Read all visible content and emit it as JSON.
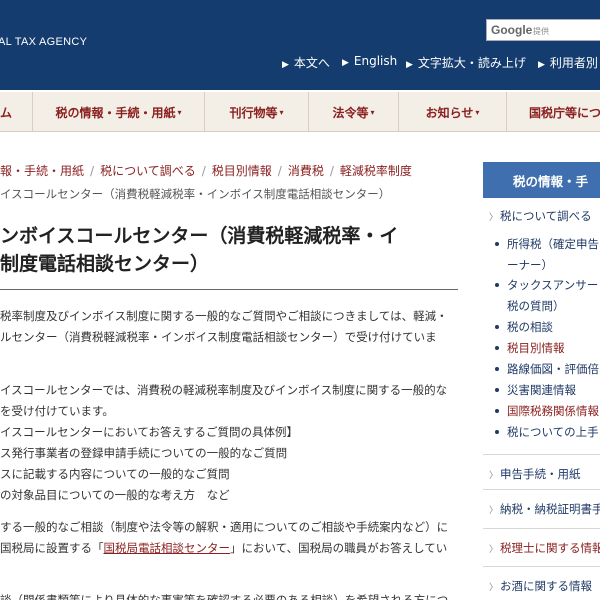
{
  "header": {
    "brand": "AL TAX AGENCY",
    "search_logo": "Google",
    "search_sub": "提供",
    "util_nav": [
      "本文へ",
      "English",
      "文字拡大・読み上げ",
      "利用者別"
    ]
  },
  "gnav": {
    "items": [
      "ム",
      "税の情報・手続・用紙",
      "刊行物等",
      "法令等",
      "お知らせ",
      "国税庁等につ"
    ]
  },
  "breadcrumb": {
    "items": [
      "報・手続・用紙",
      "税について調べる",
      "税目別情報",
      "消費税",
      "軽減税率制度"
    ],
    "current": "イスコールセンター（消費税軽減税率・インボイス制度電話相談センター）"
  },
  "main": {
    "title_line1": "ンボイスコールセンター（消費税軽減税率・イ",
    "title_line2": "制度電話相談センター）",
    "p1_line1": "税率制度及びインボイス制度に関する一般的なご質問やご相談につきましては、軽減・",
    "p1_line2": "ルセンター（消費税軽減税率・インボイス制度電話相談センター）で受け付けていま",
    "p2_line1": "イスコールセンターでは、消費税の軽減税率制度及びインボイス制度に関する一般的な",
    "p2_line2": "を受け付けています。",
    "p2_line3": "イスコールセンターにおいてお答えするご質問の具体例】",
    "p2_line4": "ス発行事業者の登録申請手続についての一般的なご質問",
    "p2_line5": "スに記載する内容についての一般的なご質問",
    "p2_line6": "の対象品目についての一般的な考え方　など",
    "p3_line1": "する一般的なご相談（制度や法令等の解釈・適用についてのご相談や手続案内など）に",
    "p3_line2_a": "国税局に設置する「",
    "p3_line2_link": "国税局電話相談センター",
    "p3_line2_b": "」において、国税局の職員がお答えしてい",
    "p4_line1": "談（関係書類等により具体的な事実等を確認する必要のある相談）を希望される方につ"
  },
  "sidebar": {
    "head": "税の情報・手",
    "links": [
      "税について調べる",
      "所得税（確定申告",
      "ーナー）",
      "タックスアンサー",
      "税の質問）",
      "税の相談",
      "税目別情報",
      "路線価図・評価倍",
      "災害関連情報",
      "国際税務関係情報",
      "税についての上手",
      "申告手続・用紙",
      "納税・納税証明書手",
      "税理士に関する情報",
      "お酒に関する情報"
    ]
  },
  "colors": {
    "header_bg": "#143c6e",
    "nav_text": "#8b2020",
    "sidebar_head": "#3f6fae"
  }
}
